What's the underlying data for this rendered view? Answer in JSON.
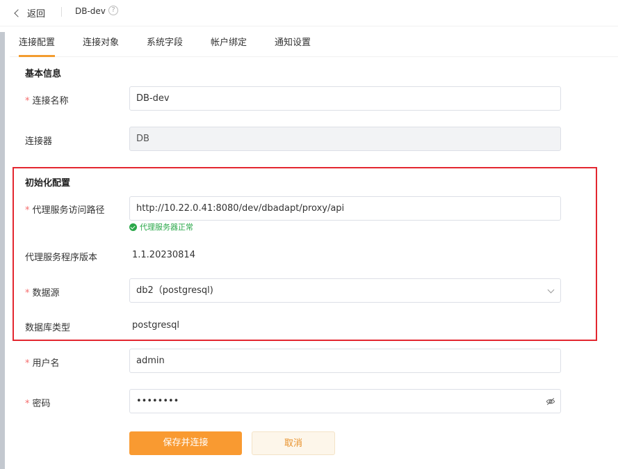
{
  "header": {
    "back_label": "返回",
    "title": "DB-dev",
    "help_glyph": "?"
  },
  "tabs": [
    {
      "label": "连接配置",
      "active": true
    },
    {
      "label": "连接对象",
      "active": false
    },
    {
      "label": "系统字段",
      "active": false
    },
    {
      "label": "帐户绑定",
      "active": false
    },
    {
      "label": "通知设置",
      "active": false
    }
  ],
  "basic": {
    "section_title": "基本信息",
    "name_label": "连接名称",
    "name_value": "DB-dev",
    "connector_label": "连接器",
    "connector_value": "DB"
  },
  "init": {
    "section_title": "初始化配置",
    "proxy_url_label": "代理服务访问路径",
    "proxy_url_value": "http://10.22.0.41:8080/dev/dbadapt/proxy/api",
    "proxy_status": "代理服务器正常",
    "proxy_version_label": "代理服务程序版本",
    "proxy_version_value": "1.1.20230814",
    "datasource_label": "数据源",
    "datasource_value": "db2（postgresql)",
    "db_type_label": "数据库类型",
    "db_type_value": "postgresql"
  },
  "auth": {
    "username_label": "用户名",
    "username_value": "admin",
    "password_label": "密码",
    "password_value": "••••••••"
  },
  "actions": {
    "save_label": "保存并连接",
    "cancel_label": "取消"
  },
  "colors": {
    "accent": "#f39c2f",
    "required": "#f56c6c",
    "success": "#2ba84a",
    "highlight": "#e3262f"
  }
}
